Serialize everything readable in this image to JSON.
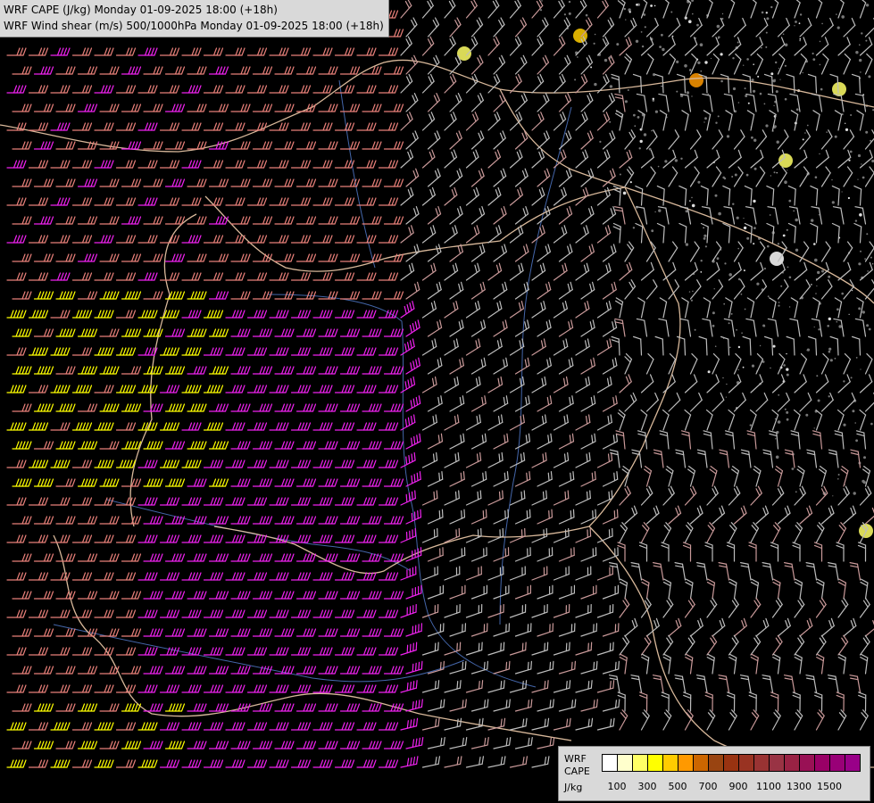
{
  "titles": {
    "line1": "WRF CAPE (J/kg) Monday 01-09-2025 18:00 (+18h)",
    "line2": "WRF Wind shear (m/s) 500/1000hPa Monday 01-09-2025 18:00 (+18h)"
  },
  "legend": {
    "label_line1": "WRF",
    "label_line2": "CAPE",
    "label_line3": "J/kg",
    "colors": [
      "#ffffff",
      "#ffffcc",
      "#ffff66",
      "#ffff00",
      "#ffcc00",
      "#ff9900",
      "#cc6600",
      "#994411",
      "#993311",
      "#993322",
      "#993333",
      "#993344",
      "#992244",
      "#991155",
      "#990066",
      "#990077",
      "#990088"
    ],
    "ticks": [
      {
        "label": "100",
        "index": 1
      },
      {
        "label": "300",
        "index": 3
      },
      {
        "label": "500",
        "index": 5
      },
      {
        "label": "700",
        "index": 7
      },
      {
        "label": "900",
        "index": 9
      },
      {
        "label": "1100",
        "index": 11
      },
      {
        "label": "1300",
        "index": 13
      },
      {
        "label": "1500",
        "index": 15
      }
    ]
  },
  "map_colors": {
    "background": "#000000",
    "shear_weak": "#bdbdbd",
    "shear_moderate": "#c99999",
    "shear_strong": "#e8807a",
    "shear_very_strong": "#ee22ee",
    "shear_extreme": "#ffff00",
    "borders": "#d8b89a",
    "rivers": "#4466aa"
  }
}
